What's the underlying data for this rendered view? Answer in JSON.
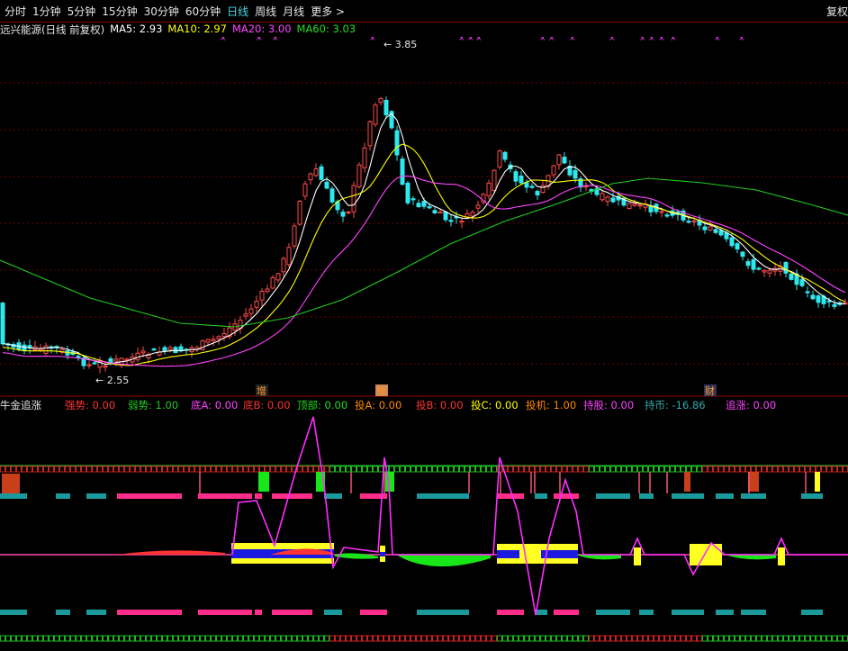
{
  "toolbar": {
    "periods": [
      "分时",
      "1分钟",
      "5分钟",
      "15分钟",
      "30分钟",
      "60分钟",
      "日线",
      "周线",
      "月线",
      "更多 >"
    ],
    "active": "日线",
    "reset_label": "复权"
  },
  "ma_bar": {
    "title": "远兴能源(日线 前复权)",
    "items": [
      {
        "text": "MA5: 2.93",
        "color": "#ffffff"
      },
      {
        "text": "MA10: 2.97",
        "color": "#ffff00"
      },
      {
        "text": "MA20: 3.00",
        "color": "#ff44ff"
      },
      {
        "text": "MA60: 3.03",
        "color": "#22dd22"
      }
    ]
  },
  "price_chart": {
    "high_label": "3.85",
    "low_label": "2.55",
    "event_markers": [
      {
        "text": "增",
        "bg": "#222"
      },
      {
        "text": "榜",
        "bg": "#c85"
      },
      {
        "text": "财",
        "bg": "#335"
      }
    ]
  },
  "indicator": {
    "name": "牛金追涨",
    "values": [
      {
        "label": "强势: 0.00",
        "color": "#ff3333"
      },
      {
        "label": "弱势: 1.00",
        "color": "#22cc22"
      },
      {
        "label": "底A: 0.00",
        "color": "#ff44ff"
      },
      {
        "label": "底B: 0.00",
        "color": "#ff3333"
      },
      {
        "label": "顶部: 0.00",
        "color": "#22dd22"
      },
      {
        "label": "投A: 0.00",
        "color": "#ff8800"
      },
      {
        "label": "投B: 0.00",
        "color": "#ff3333"
      },
      {
        "label": "投C: 0.00",
        "color": "#ffff00"
      },
      {
        "label": "投机: 1.00",
        "color": "#ff8800"
      },
      {
        "label": "持股: 0.00",
        "color": "#ff44ff"
      },
      {
        "label": "持币: -16.86",
        "color": "#33aaaa"
      },
      {
        "label": "追涨: 0.00",
        "color": "#ff44ff"
      }
    ]
  }
}
